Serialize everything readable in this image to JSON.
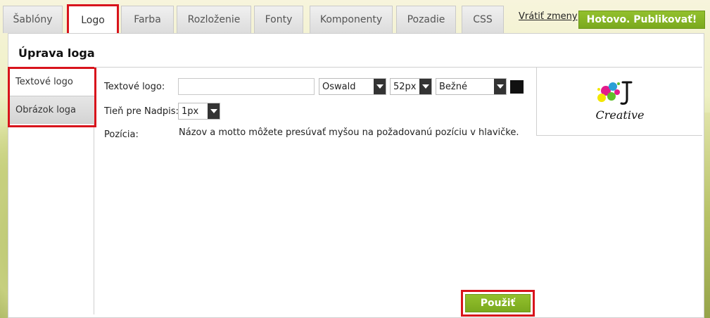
{
  "tabs": [
    {
      "label": "Šablóny"
    },
    {
      "label": "Logo"
    },
    {
      "label": "Farba"
    },
    {
      "label": "Rozloženie"
    },
    {
      "label": "Fonty"
    },
    {
      "label": "Komponenty"
    },
    {
      "label": "Pozadie"
    },
    {
      "label": "CSS"
    }
  ],
  "header": {
    "revert_label": "Vrátiť zmeny",
    "publish_label": "Hotovo. Publikovať!"
  },
  "panel": {
    "title": "Úprava loga",
    "sub_tabs": [
      {
        "label": "Textové logo"
      },
      {
        "label": "Obrázok loga"
      }
    ],
    "form": {
      "text_logo_label": "Textové logo:",
      "text_logo_value": "",
      "font_select": "Oswald",
      "size_select": "52px",
      "style_select": "Bežné",
      "color": "#111111",
      "shadow_label": "Tieň pre Nadpis:",
      "shadow_select": "1px",
      "position_label": "Pozícia:",
      "position_text": "Názov a motto môžete presúvať myšou na požadovanú pozíciu v hlavičke."
    },
    "apply_label": "Použiť",
    "logo_preview": {
      "icon": "creative-logo-icon",
      "text": "Creative"
    }
  },
  "colors": {
    "accent_green": "#86b525",
    "highlight_red": "#d8141c"
  }
}
